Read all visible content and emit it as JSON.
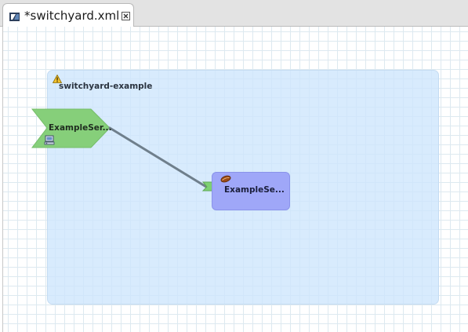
{
  "editor_tab": {
    "title": "*switchyard.xml",
    "icon": "switchyard-file-icon",
    "close_icon": "close-icon"
  },
  "canvas": {
    "composite": {
      "name": "switchyard-example",
      "status_icon": "warning-icon"
    },
    "composite_service": {
      "label": "ExampleSer...",
      "binding_icon": "binding-icon",
      "color": "#86cf7a"
    },
    "component": {
      "label": "ExampleSe...",
      "icon": "bean-icon",
      "color": "#9fa7f8"
    },
    "wire_color": "#6f7f8c"
  }
}
